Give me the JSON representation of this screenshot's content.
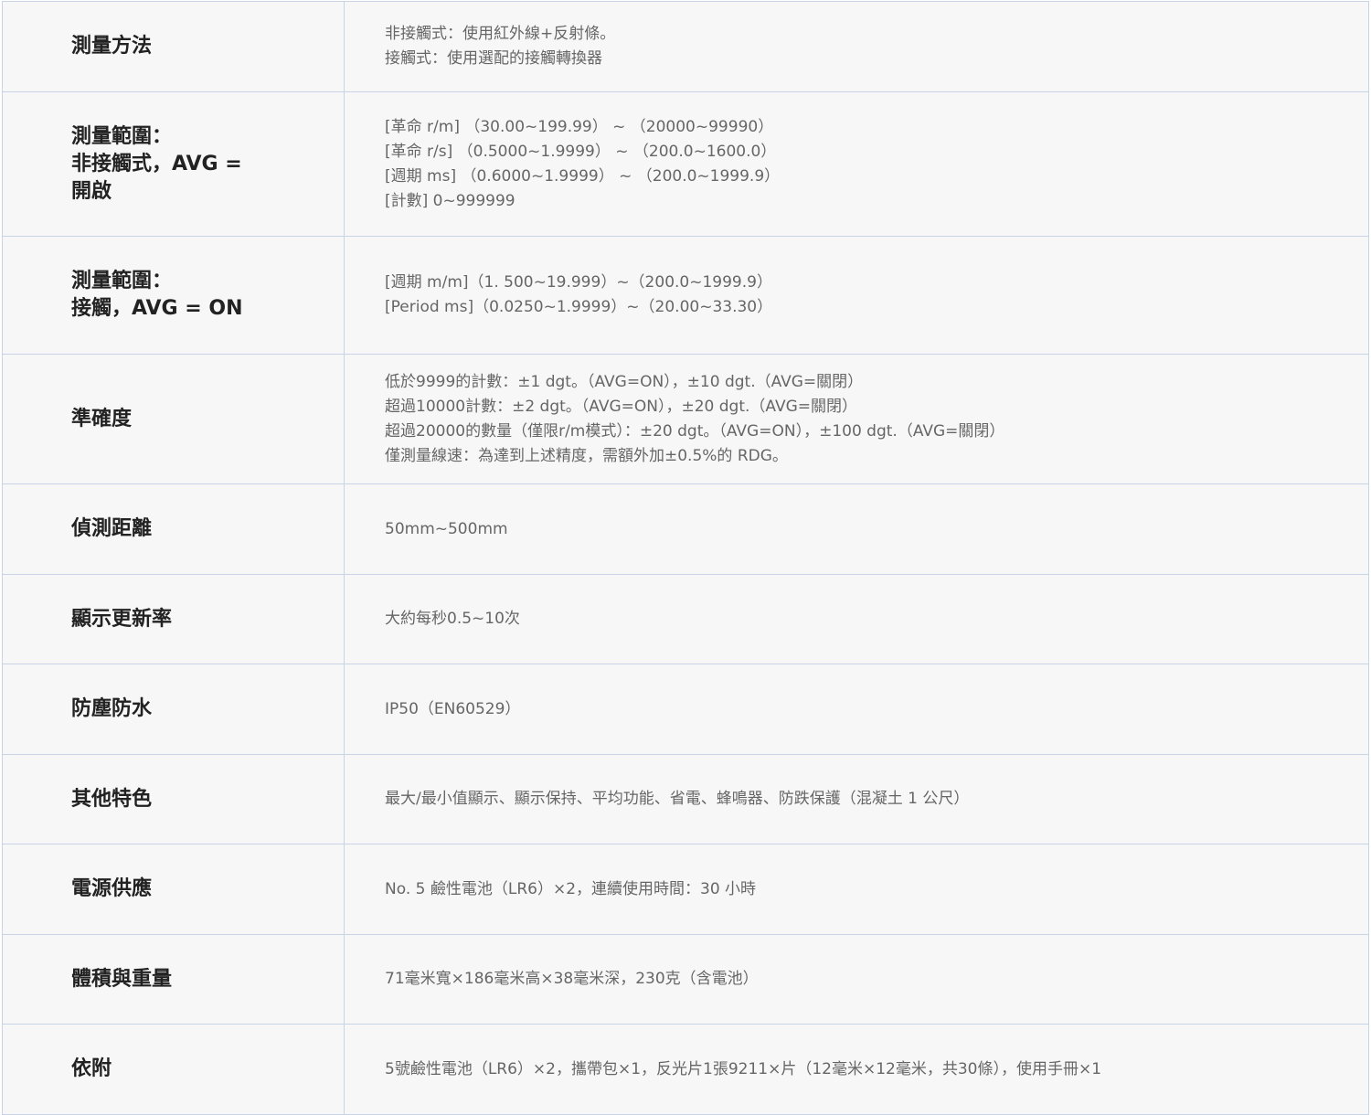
{
  "rows": [
    {
      "label": [
        "測量方法"
      ],
      "value": [
        "非接觸式：使用紅外線+反射條。",
        "接觸式：使用選配的接觸轉換器"
      ]
    },
    {
      "label": [
        "測量範圍：",
        "非接觸式，AVG =",
        "開啟"
      ],
      "value": [
        "[革命 r/m] （30.00~199.99） ~ （20000~99990）",
        "[革命 r/s] （0.5000~1.9999） ~ （200.0~1600.0）",
        "[週期 ms] （0.6000~1.9999） ~ （200.0~1999.9）",
        "[計數] 0~999999"
      ]
    },
    {
      "label": [
        "測量範圍：",
        "接觸，AVG = ON"
      ],
      "value": [
        "[週期 m/m]（1. 500~19.999）~（200.0~1999.9）",
        "[Period ms]（0.0250~1.9999）~（20.00~33.30）"
      ]
    },
    {
      "label": [
        "準確度"
      ],
      "value": [
        "低於9999的計數：±1 dgt。（AVG=ON），±10 dgt.（AVG=關閉）",
        "超過10000計數：±2 dgt。（AVG=ON），±20 dgt.（AVG=關閉）",
        "超過20000的數量（僅限r/m模式）：±20 dgt。（AVG=ON），±100 dgt.（AVG=關閉）",
        "僅測量線速：為達到上述精度，需額外加±0.5%的 RDG。"
      ]
    },
    {
      "label": [
        "偵測距離"
      ],
      "value": [
        "50mm~500mm"
      ]
    },
    {
      "label": [
        "顯示更新率"
      ],
      "value": [
        "大約每秒0.5~10次"
      ]
    },
    {
      "label": [
        "防塵防水"
      ],
      "value": [
        "IP50（EN60529）"
      ]
    },
    {
      "label": [
        "其他特色"
      ],
      "value": [
        "最大/最小值顯示、顯示保持、平均功能、省電、蜂鳴器、防跌保護（混凝土 1 公尺）"
      ]
    },
    {
      "label": [
        "電源供應"
      ],
      "value": [
        "No. 5 鹼性電池（LR6）×2，連續使用時間：30 小時"
      ]
    },
    {
      "label": [
        "體積與重量"
      ],
      "value": [
        "71毫米寬×186毫米高×38毫米深，230克（含電池）"
      ]
    },
    {
      "label": [
        "依附"
      ],
      "value": [
        "5號鹼性電池（LR6）×2，攜帶包×1，反光片1張9211×片（12毫米×12毫米，共30條），使用手冊×1"
      ]
    }
  ]
}
